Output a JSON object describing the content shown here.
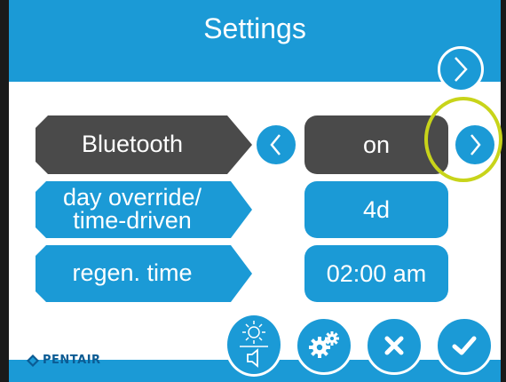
{
  "header": {
    "title": "Settings"
  },
  "rows": [
    {
      "label": "Bluetooth",
      "value": "on",
      "selected": true
    },
    {
      "label_line1": "day override/",
      "label_line2": "time-driven",
      "value": "4d",
      "selected": false
    },
    {
      "label": "regen. time",
      "value": "02:00 am",
      "selected": false
    }
  ],
  "logo": {
    "text": "PENTAIR"
  },
  "colors": {
    "accent": "#1b9ad6",
    "selected": "#4a4a4a",
    "highlight": "#c8d41a",
    "logo": "#0b5b93"
  },
  "icons": {
    "next_page": "chevron-right-icon",
    "prev_value": "chevron-left-icon",
    "next_value": "chevron-right-icon",
    "display_sound": "sun-speaker-icon",
    "advanced": "gears-icon",
    "cancel": "x-icon",
    "confirm": "check-icon"
  }
}
